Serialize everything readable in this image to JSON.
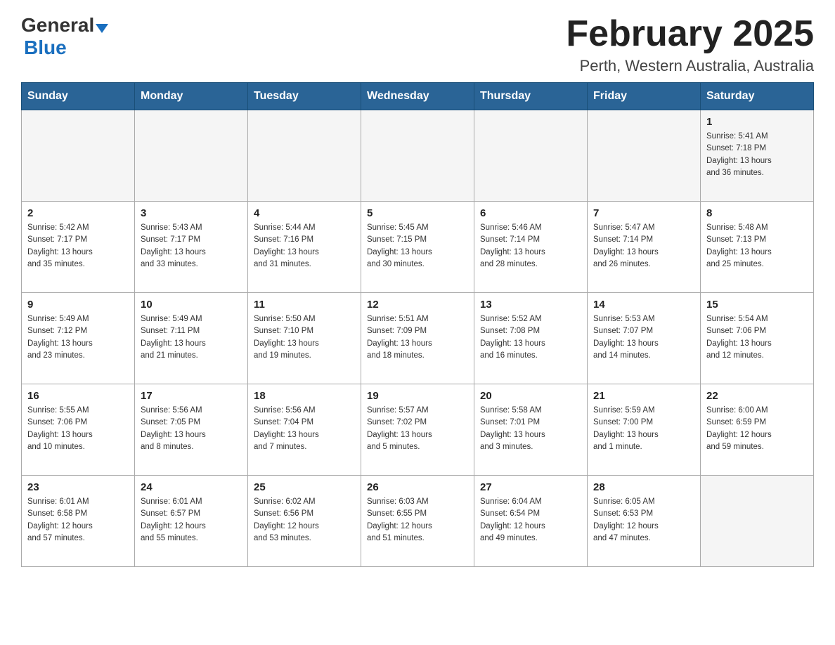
{
  "header": {
    "logo_general": "General",
    "logo_blue": "Blue",
    "title": "February 2025",
    "subtitle": "Perth, Western Australia, Australia"
  },
  "weekdays": [
    "Sunday",
    "Monday",
    "Tuesday",
    "Wednesday",
    "Thursday",
    "Friday",
    "Saturday"
  ],
  "rows": [
    [
      {
        "day": "",
        "info": ""
      },
      {
        "day": "",
        "info": ""
      },
      {
        "day": "",
        "info": ""
      },
      {
        "day": "",
        "info": ""
      },
      {
        "day": "",
        "info": ""
      },
      {
        "day": "",
        "info": ""
      },
      {
        "day": "1",
        "info": "Sunrise: 5:41 AM\nSunset: 7:18 PM\nDaylight: 13 hours\nand 36 minutes."
      }
    ],
    [
      {
        "day": "2",
        "info": "Sunrise: 5:42 AM\nSunset: 7:17 PM\nDaylight: 13 hours\nand 35 minutes."
      },
      {
        "day": "3",
        "info": "Sunrise: 5:43 AM\nSunset: 7:17 PM\nDaylight: 13 hours\nand 33 minutes."
      },
      {
        "day": "4",
        "info": "Sunrise: 5:44 AM\nSunset: 7:16 PM\nDaylight: 13 hours\nand 31 minutes."
      },
      {
        "day": "5",
        "info": "Sunrise: 5:45 AM\nSunset: 7:15 PM\nDaylight: 13 hours\nand 30 minutes."
      },
      {
        "day": "6",
        "info": "Sunrise: 5:46 AM\nSunset: 7:14 PM\nDaylight: 13 hours\nand 28 minutes."
      },
      {
        "day": "7",
        "info": "Sunrise: 5:47 AM\nSunset: 7:14 PM\nDaylight: 13 hours\nand 26 minutes."
      },
      {
        "day": "8",
        "info": "Sunrise: 5:48 AM\nSunset: 7:13 PM\nDaylight: 13 hours\nand 25 minutes."
      }
    ],
    [
      {
        "day": "9",
        "info": "Sunrise: 5:49 AM\nSunset: 7:12 PM\nDaylight: 13 hours\nand 23 minutes."
      },
      {
        "day": "10",
        "info": "Sunrise: 5:49 AM\nSunset: 7:11 PM\nDaylight: 13 hours\nand 21 minutes."
      },
      {
        "day": "11",
        "info": "Sunrise: 5:50 AM\nSunset: 7:10 PM\nDaylight: 13 hours\nand 19 minutes."
      },
      {
        "day": "12",
        "info": "Sunrise: 5:51 AM\nSunset: 7:09 PM\nDaylight: 13 hours\nand 18 minutes."
      },
      {
        "day": "13",
        "info": "Sunrise: 5:52 AM\nSunset: 7:08 PM\nDaylight: 13 hours\nand 16 minutes."
      },
      {
        "day": "14",
        "info": "Sunrise: 5:53 AM\nSunset: 7:07 PM\nDaylight: 13 hours\nand 14 minutes."
      },
      {
        "day": "15",
        "info": "Sunrise: 5:54 AM\nSunset: 7:06 PM\nDaylight: 13 hours\nand 12 minutes."
      }
    ],
    [
      {
        "day": "16",
        "info": "Sunrise: 5:55 AM\nSunset: 7:06 PM\nDaylight: 13 hours\nand 10 minutes."
      },
      {
        "day": "17",
        "info": "Sunrise: 5:56 AM\nSunset: 7:05 PM\nDaylight: 13 hours\nand 8 minutes."
      },
      {
        "day": "18",
        "info": "Sunrise: 5:56 AM\nSunset: 7:04 PM\nDaylight: 13 hours\nand 7 minutes."
      },
      {
        "day": "19",
        "info": "Sunrise: 5:57 AM\nSunset: 7:02 PM\nDaylight: 13 hours\nand 5 minutes."
      },
      {
        "day": "20",
        "info": "Sunrise: 5:58 AM\nSunset: 7:01 PM\nDaylight: 13 hours\nand 3 minutes."
      },
      {
        "day": "21",
        "info": "Sunrise: 5:59 AM\nSunset: 7:00 PM\nDaylight: 13 hours\nand 1 minute."
      },
      {
        "day": "22",
        "info": "Sunrise: 6:00 AM\nSunset: 6:59 PM\nDaylight: 12 hours\nand 59 minutes."
      }
    ],
    [
      {
        "day": "23",
        "info": "Sunrise: 6:01 AM\nSunset: 6:58 PM\nDaylight: 12 hours\nand 57 minutes."
      },
      {
        "day": "24",
        "info": "Sunrise: 6:01 AM\nSunset: 6:57 PM\nDaylight: 12 hours\nand 55 minutes."
      },
      {
        "day": "25",
        "info": "Sunrise: 6:02 AM\nSunset: 6:56 PM\nDaylight: 12 hours\nand 53 minutes."
      },
      {
        "day": "26",
        "info": "Sunrise: 6:03 AM\nSunset: 6:55 PM\nDaylight: 12 hours\nand 51 minutes."
      },
      {
        "day": "27",
        "info": "Sunrise: 6:04 AM\nSunset: 6:54 PM\nDaylight: 12 hours\nand 49 minutes."
      },
      {
        "day": "28",
        "info": "Sunrise: 6:05 AM\nSunset: 6:53 PM\nDaylight: 12 hours\nand 47 minutes."
      },
      {
        "day": "",
        "info": ""
      }
    ]
  ]
}
